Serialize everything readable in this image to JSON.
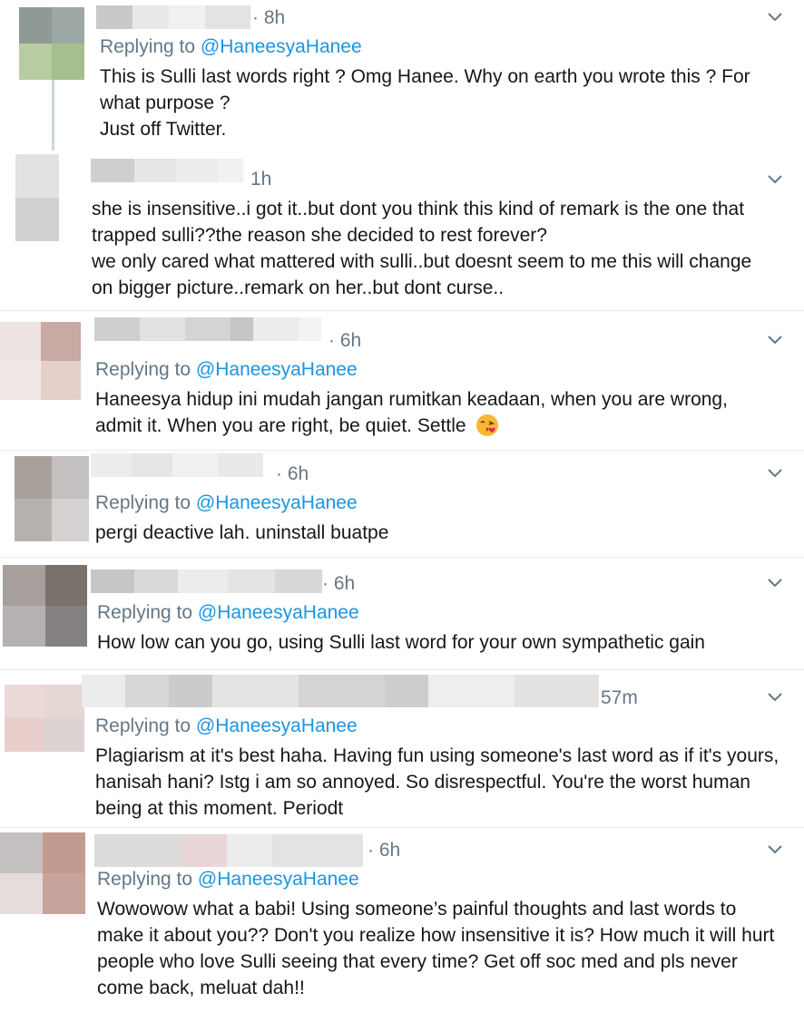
{
  "tweets": [
    {
      "time": "· 8h",
      "replying_label": "Replying to",
      "replying_handle": "@HaneesyaHanee",
      "text": "This is Sulli last words right ? Omg Hanee. Why on earth you wrote this ? For what purpose ?\nJust off Twitter.",
      "avatar_colors": [
        "#8f9a97",
        "#9da7a3",
        "#b7cca1",
        "#a7bf8f"
      ],
      "name_blur": [
        "#c9c9c9",
        "#e8e8e8",
        "#f1f1f1",
        "#e3e3e3",
        "#eeeeee"
      ]
    },
    {
      "time": "1h",
      "replying_label": "",
      "replying_handle": "",
      "text": "she is insensitive..i got it..but dont you think this kind of remark is the one that trapped sulli??the reason she decided to rest forever?\nwe only cared what mattered with sulli..but doesnt seem to me this will change on bigger picture..remark on her..but dont curse..",
      "avatar_colors": [
        "#dddddd",
        "#ececec",
        "#cfcfcf",
        "#e6e6e6"
      ],
      "name_blur": [
        "#cfcfcf",
        "#e6e6e6",
        "#ececec",
        "#f1f1f1",
        "#dcdcdc"
      ]
    },
    {
      "time": "· 6h",
      "replying_label": "Replying to",
      "replying_handle": "@HaneesyaHanee",
      "text": "Haneesya hidup ini mudah jangan rumitkan keadaan, when you are wrong, admit it. When you are right, be quiet. Settle",
      "avatar_colors": [
        "#ede3e1",
        "#c8a9a3",
        "#f1e8e5",
        "#e4d0c8"
      ],
      "name_blur": [
        "#cfcfcf",
        "#e2e2e2",
        "#d4d4d4",
        "#c6c6c6",
        "#ececec",
        "#f3f3f3"
      ]
    },
    {
      "time": "· 6h",
      "replying_label": "Replying to",
      "replying_handle": "@HaneesyaHanee",
      "text": "pergi deactive lah. uninstall buatpe",
      "avatar_colors": [
        "#a9a09c",
        "#c4c0bf",
        "#b7b1ae",
        "#d4d1d0"
      ],
      "name_blur": [
        "#ededed",
        "#e6e6e6",
        "#f1f1f1",
        "#e9e9e9"
      ]
    },
    {
      "time": "· 6h",
      "replying_label": "Replying to",
      "replying_handle": "@HaneesyaHanee",
      "text": "How low can you go, using Sulli last word for your own sympathetic gain",
      "avatar_colors": [
        "#a69f9c",
        "#7a716d",
        "#b6b2b1",
        "#858180"
      ],
      "name_blur": [
        "#c6c6c6",
        "#d9d9d9",
        "#ececec",
        "#e4e4e4",
        "#d8d8d8"
      ]
    },
    {
      "time": "57m",
      "replying_label": "Replying to",
      "replying_handle": "@HaneesyaHanee",
      "text": "Plagiarism at it's best haha. Having fun using someone's last word as if it's yours, hanisah hani? Istg i am so annoyed. So disrespectful. You're the worst human being at this moment. Periodt",
      "avatar_colors": [
        "#ead9d6",
        "#e4d7d4",
        "#e8cfcc",
        "#ddd3d1"
      ],
      "name_blur": [
        "#ececec",
        "#d7d7d7",
        "#cbcbcb",
        "#e4e4e4",
        "#d4d4d4",
        "#cdcdcd",
        "#eeeeee",
        "#e2e2e2"
      ]
    },
    {
      "time": "· 6h",
      "replying_label": "Replying to",
      "replying_handle": "@HaneesyaHanee",
      "text": "Wowowow what a babi! Using someone’s painful thoughts and last words to make it about you?? Don't you realize how insensitive it is? How much it will hurt people who love Sulli seeing that every time? Get off soc med and pls never come back, meluat dah!!",
      "avatar_colors": [
        "#c5c0c0",
        "#c39a90",
        "#e6dcdc",
        "#c8a39b"
      ],
      "name_blur": [
        "#dcdcdc",
        "#e8d6d8",
        "#ececec",
        "#e3e3e3"
      ]
    }
  ]
}
